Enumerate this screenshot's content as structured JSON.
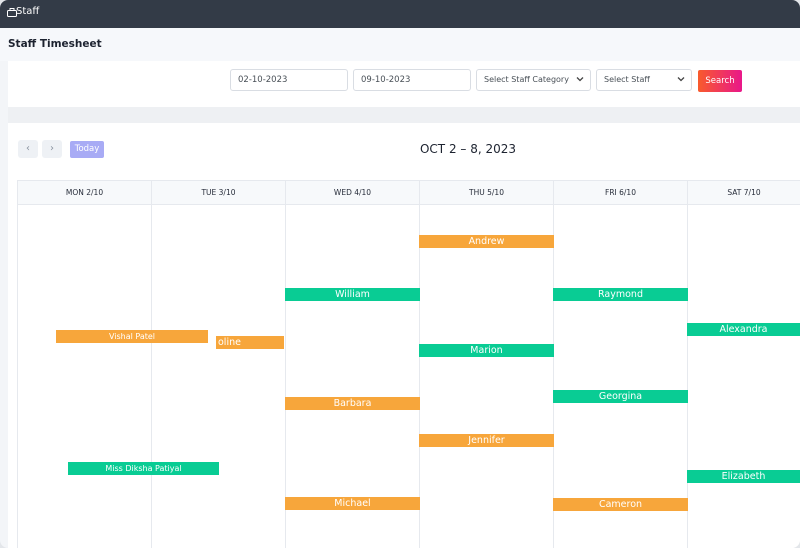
{
  "window": {
    "title": "Staff"
  },
  "page": {
    "title": "Staff Timesheet"
  },
  "filters": {
    "start_date": "02-10-2023",
    "end_date": "09-10-2023",
    "staff_category": "Select Staff Category",
    "staff": "Select Staff",
    "search_label": "Search"
  },
  "calendar": {
    "today_label": "Today",
    "prev_label": "‹",
    "next_label": "›",
    "title": "OCT 2 – 8, 2023",
    "days": [
      "MON 2/10",
      "TUE 3/10",
      "WED 4/10",
      "THU 5/10",
      "FRI 6/10",
      "SAT 7/10"
    ],
    "events": [
      {
        "name": "Andrew",
        "color": "orange"
      },
      {
        "name": "William",
        "color": "green"
      },
      {
        "name": "Raymond",
        "color": "green"
      },
      {
        "name": "Alexandra",
        "color": "green"
      },
      {
        "name": "Vishal Patel",
        "color": "orange"
      },
      {
        "name": "oline",
        "color": "orange"
      },
      {
        "name": "Marion",
        "color": "green"
      },
      {
        "name": "Georgina",
        "color": "green"
      },
      {
        "name": "Barbara",
        "color": "orange"
      },
      {
        "name": "Jennifer",
        "color": "orange"
      },
      {
        "name": "Miss Diksha Patiyal",
        "color": "green"
      },
      {
        "name": "Elizabeth",
        "color": "green"
      },
      {
        "name": "Michael",
        "color": "orange"
      },
      {
        "name": "Cameron",
        "color": "orange"
      }
    ]
  },
  "colors": {
    "orange": "#f7a63b",
    "green": "#09cc94",
    "titlebar": "#333b47",
    "today": "#a8abf5"
  }
}
